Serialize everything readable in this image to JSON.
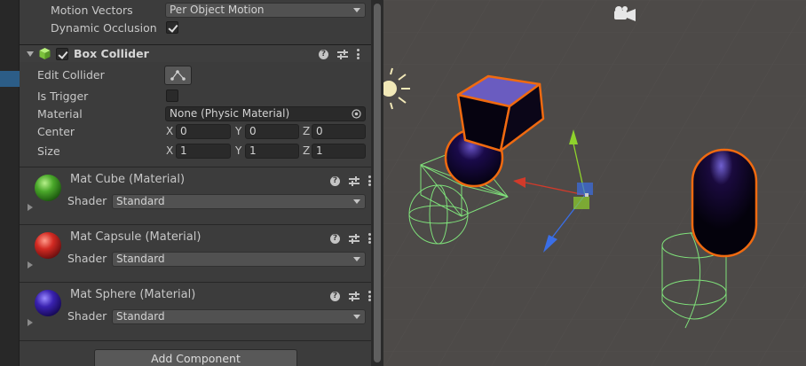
{
  "inspector": {
    "rendering": {
      "motion_vectors_label": "Motion Vectors",
      "motion_vectors_value": "Per Object Motion",
      "dynamic_occlusion_label": "Dynamic Occlusion",
      "dynamic_occlusion_checked": true
    },
    "box_collider": {
      "title": "Box Collider",
      "enabled": true,
      "edit_collider_label": "Edit Collider",
      "is_trigger_label": "Is Trigger",
      "is_trigger_checked": false,
      "material_label": "Material",
      "material_value": "None (Physic Material)",
      "center_label": "Center",
      "center": {
        "x_label": "X",
        "x": "0",
        "y_label": "Y",
        "y": "0",
        "z_label": "Z",
        "z": "0"
      },
      "size_label": "Size",
      "size": {
        "x_label": "X",
        "x": "1",
        "y_label": "Y",
        "y": "1",
        "z_label": "Z",
        "z": "1"
      }
    },
    "materials": [
      {
        "title": "Mat Cube (Material)",
        "shader_label": "Shader",
        "shader_value": "Standard",
        "color": "#2e8b1e"
      },
      {
        "title": "Mat Capsule (Material)",
        "shader_label": "Shader",
        "shader_value": "Standard",
        "color": "#b01a1a"
      },
      {
        "title": "Mat Sphere (Material)",
        "shader_label": "Shader",
        "shader_value": "Standard",
        "color": "#24107a"
      }
    ],
    "add_component_label": "Add Component"
  },
  "scene": {
    "selection_outline_color": "#f06a10",
    "collider_gizmo_color": "#7fe07a",
    "axis_colors": {
      "x": "#d23a2a",
      "y": "#8ed22c",
      "z": "#3a6ee6"
    },
    "icons": [
      "camera-icon",
      "directional-light-icon"
    ]
  },
  "colors": {
    "panel_bg": "#3c3c3c",
    "field_bg": "#2a2a2a",
    "selection_blue": "#2c5d87"
  }
}
